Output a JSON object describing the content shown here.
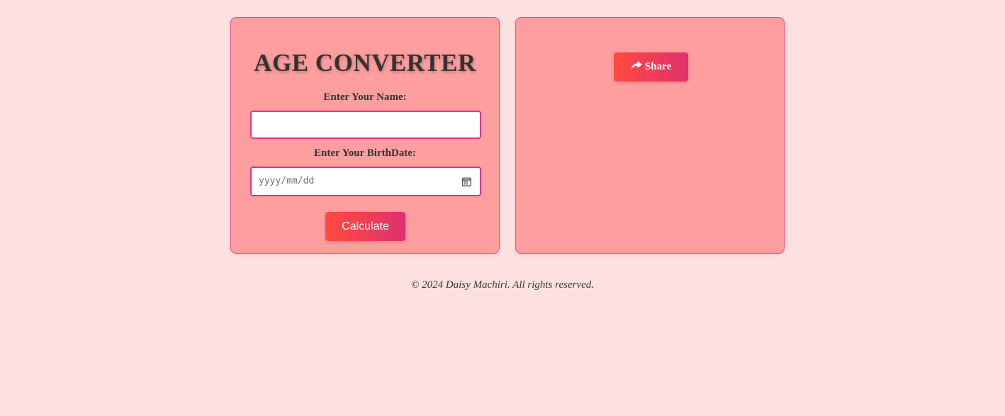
{
  "converter": {
    "title": "AGE CONVERTER",
    "name_label": "Enter Your Name:",
    "name_value": "",
    "birthdate_label": "Enter Your BirthDate:",
    "birthdate_placeholder": "yyyy/mm/dd",
    "calculate_label": "Calculate"
  },
  "share": {
    "button_label": "Share",
    "icon": "share-arrow-icon"
  },
  "footer": {
    "text": "© 2024 Daisy Machiri. All rights reserved."
  },
  "colors": {
    "page_background": "#fde1e1",
    "card_background": "#ff9e9e",
    "card_border": "#e0508a",
    "button_gradient_start": "#ff4b3e",
    "button_gradient_end": "#e0306e",
    "input_border": "#e0338a"
  }
}
